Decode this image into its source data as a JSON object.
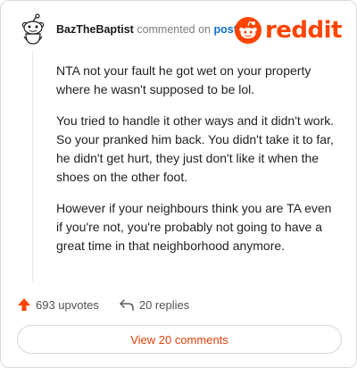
{
  "comment": {
    "username": "BazTheBaptist",
    "action_text": "commented on",
    "post_link": "post",
    "paragraphs": [
      "NTA not your fault he got wet on your property where he wasn't supposed to be lol.",
      "You tried to handle it other ways and it didn't work. So your pranked him back. You didn't take it to far, he didn't get hurt, they just don't like it when the shoes on the other foot.",
      "However if your neighbours think you are TA even if you're not, you're probably not going to have a great time in that neighborhood anymore."
    ]
  },
  "brand": {
    "wordmark": "reddit",
    "color": "#ff4500",
    "icon": "reddit-snoo-icon"
  },
  "actions": {
    "upvotes": "693 upvotes",
    "replies": "20 replies",
    "upvote_icon": "upvote-arrow-icon",
    "reply_icon": "reply-arrow-icon"
  },
  "footer": {
    "view_comments": "View 20 comments"
  },
  "colors": {
    "accent": "#ff4500",
    "link": "#0f6fd1",
    "muted": "#7c7c7c"
  }
}
